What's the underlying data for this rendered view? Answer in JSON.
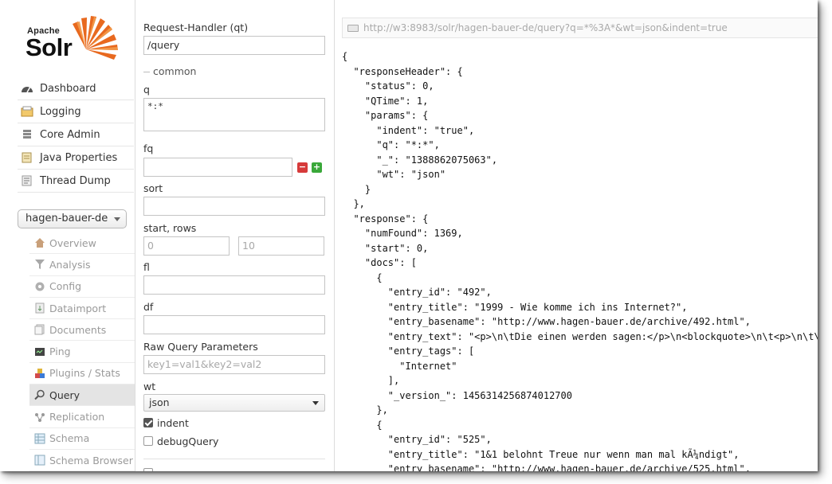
{
  "logo": {
    "apache": "Apache",
    "solr": "Solr"
  },
  "sidebar": {
    "menu": [
      {
        "label": "Dashboard",
        "icon": "dashboard-icon"
      },
      {
        "label": "Logging",
        "icon": "logging-icon"
      },
      {
        "label": "Core Admin",
        "icon": "core-admin-icon"
      },
      {
        "label": "Java Properties",
        "icon": "java-properties-icon"
      },
      {
        "label": "Thread Dump",
        "icon": "thread-dump-icon"
      }
    ],
    "core_selector": "hagen-bauer-de",
    "core_menu": [
      {
        "label": "Overview",
        "icon": "overview-icon"
      },
      {
        "label": "Analysis",
        "icon": "analysis-icon"
      },
      {
        "label": "Config",
        "icon": "config-icon"
      },
      {
        "label": "Dataimport",
        "icon": "dataimport-icon"
      },
      {
        "label": "Documents",
        "icon": "documents-icon"
      },
      {
        "label": "Ping",
        "icon": "ping-icon"
      },
      {
        "label": "Plugins / Stats",
        "icon": "plugins-icon"
      },
      {
        "label": "Query",
        "icon": "query-icon",
        "active": true
      },
      {
        "label": "Replication",
        "icon": "replication-icon"
      },
      {
        "label": "Schema",
        "icon": "schema-icon"
      },
      {
        "label": "Schema Browser",
        "icon": "schema-browser-icon"
      }
    ]
  },
  "form": {
    "request_handler_label": "Request-Handler (qt)",
    "request_handler_value": "/query",
    "common_legend": "common",
    "q_label": "q",
    "q_value": "*:*",
    "fq_label": "fq",
    "fq_value": "",
    "fq_remove": "−",
    "fq_add": "+",
    "sort_label": "sort",
    "sort_value": "",
    "start_rows_label": "start, rows",
    "start_placeholder": "0",
    "rows_placeholder": "10",
    "fl_label": "fl",
    "fl_value": "",
    "df_label": "df",
    "df_value": "",
    "raw_label": "Raw Query Parameters",
    "raw_placeholder": "key1=val1&key2=val2",
    "wt_label": "wt",
    "wt_value": "json",
    "indent_label": "indent",
    "indent_checked": true,
    "debug_label": "debugQuery",
    "debug_checked": false
  },
  "response": {
    "url": "http://w3:8983/solr/hagen-bauer-de/query?q=*%3A*&wt=json&indent=true",
    "json_text": "{\n  \"responseHeader\": {\n    \"status\": 0,\n    \"QTime\": 1,\n    \"params\": {\n      \"indent\": \"true\",\n      \"q\": \"*:*\",\n      \"_\": \"1388862075063\",\n      \"wt\": \"json\"\n    }\n  },\n  \"response\": {\n    \"numFound\": 1369,\n    \"start\": 0,\n    \"docs\": [\n      {\n        \"entry_id\": \"492\",\n        \"entry_title\": \"1999 - Wie komme ich ins Internet?\",\n        \"entry_basename\": \"http://www.hagen-bauer.de/archive/492.html\",\n        \"entry_text\": \"<p>\\n\\tDie einen werden sagen:</p>\\n<blockquote>\\n\\t<p>\\n\\t\\tStimmt d\n        \"entry_tags\": [\n          \"Internet\"\n        ],\n        \"_version_\": 1456314256874012700\n      },\n      {\n        \"entry_id\": \"525\",\n        \"entry_title\": \"1&1 belohnt Treue nur wenn man mal kÃ¼ndigt\",\n        \"entry_basename\": \"http://www.hagen-bauer.de/archive/525.html\","
  },
  "colors": {
    "remove": "#d63a3a",
    "add": "#3aa83a",
    "active_bg": "#e4e4e4",
    "logo_rays": "#e8691f"
  }
}
